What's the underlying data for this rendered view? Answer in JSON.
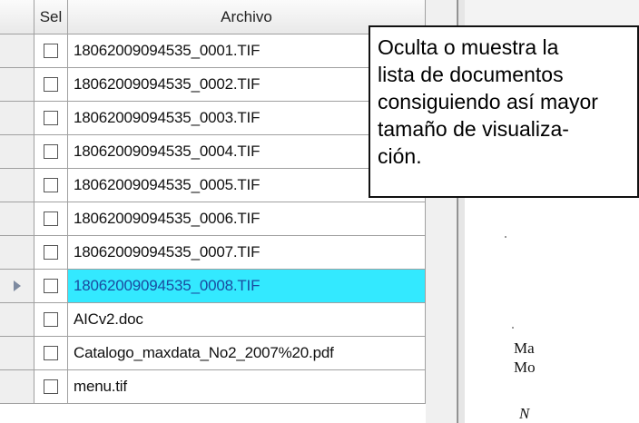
{
  "header": {
    "sel_label": "Sel",
    "file_label": "Archivo"
  },
  "files": [
    {
      "name": "18062009094535_0001.TIF",
      "selected": false
    },
    {
      "name": "18062009094535_0002.TIF",
      "selected": false
    },
    {
      "name": "18062009094535_0003.TIF",
      "selected": false
    },
    {
      "name": "18062009094535_0004.TIF",
      "selected": false
    },
    {
      "name": "18062009094535_0005.TIF",
      "selected": false
    },
    {
      "name": "18062009094535_0006.TIF",
      "selected": false
    },
    {
      "name": "18062009094535_0007.TIF",
      "selected": false
    },
    {
      "name": "18062009094535_0008.TIF",
      "selected": true
    },
    {
      "name": "AICv2.doc",
      "selected": false
    },
    {
      "name": "Catalogo_maxdata_No2_2007%20.pdf",
      "selected": false
    },
    {
      "name": "menu.tif",
      "selected": false
    }
  ],
  "callout": {
    "lines": [
      "Oculta o muestra la",
      "lista de documentos",
      "consiguiendo así mayor",
      "tamaño de visualiza-",
      "ción."
    ]
  },
  "preview": {
    "lines": [
      "Ma",
      "Mo",
      "N"
    ]
  },
  "colors": {
    "selected_row_bg": "#33e9ff",
    "selected_row_text": "#1b4ba0"
  }
}
